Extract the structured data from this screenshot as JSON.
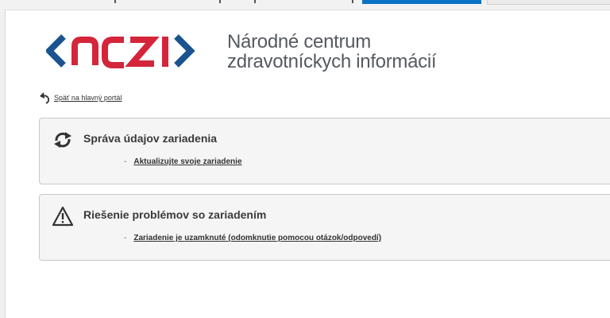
{
  "header": {
    "logo_text": "NCZI",
    "org_name_line1": "Národné centrum",
    "org_name_line2": "zdravotníckych informácií"
  },
  "back_link": {
    "label": "Späť na hlavný portál"
  },
  "sections": [
    {
      "title": "Správa údajov zariadenia",
      "icon": "sync-icon",
      "links": [
        {
          "label": "Aktualizujte svoje zariadenie"
        }
      ]
    },
    {
      "title": "Riešenie problémov so zariadením",
      "icon": "warning-icon",
      "links": [
        {
          "label": "Zariadenie je uzamknuté (odomknutie pomocou otázok/odpovedí)"
        }
      ]
    }
  ],
  "colors": {
    "brand_blue": "#1a5390",
    "brand_red": "#d4253b",
    "panel_bg": "#f5f5f5",
    "top_button_blue": "#0a72c4"
  }
}
